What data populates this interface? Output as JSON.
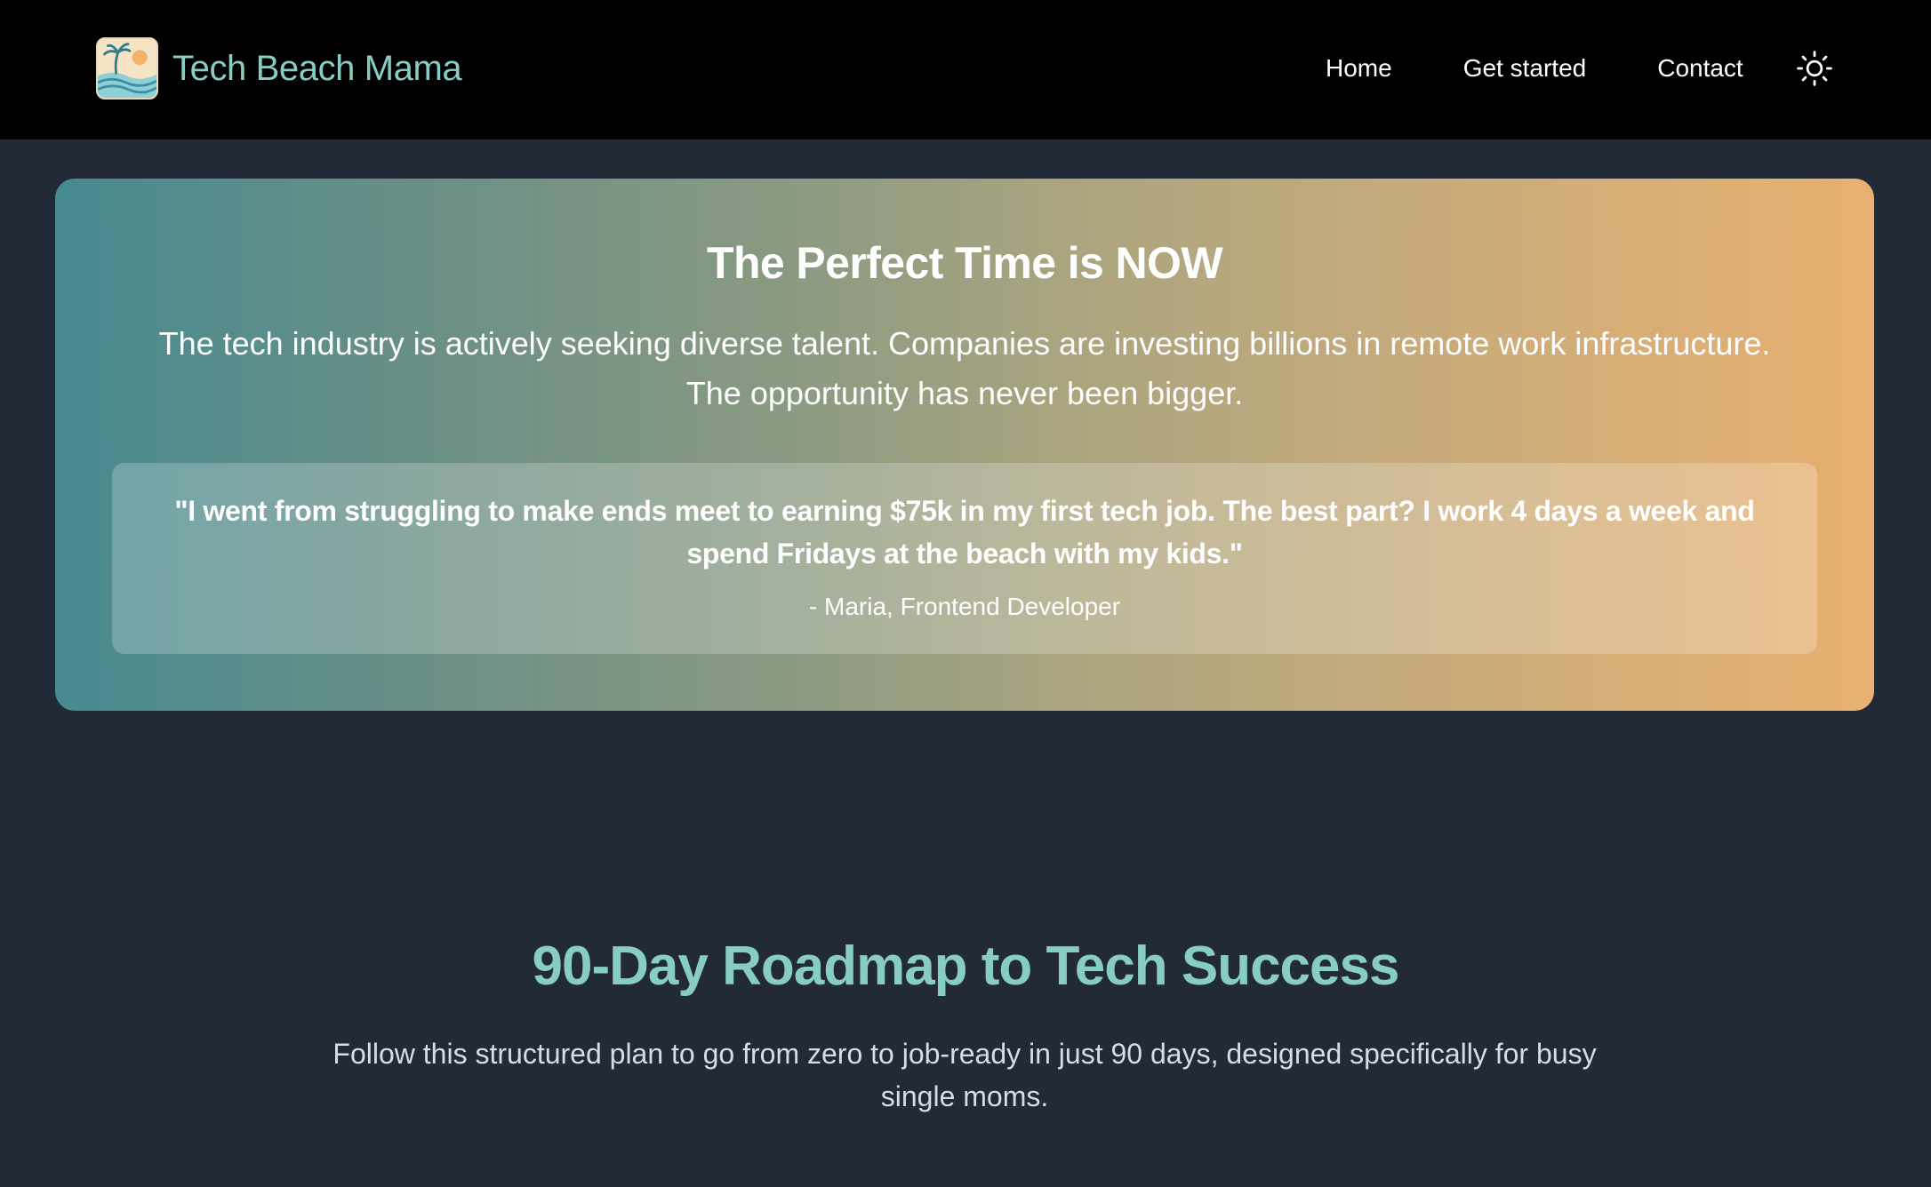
{
  "navbar": {
    "brand": {
      "name": "Tech Beach Mama",
      "logo_icon": "palm-beach-logo"
    },
    "links": [
      {
        "label": "Home"
      },
      {
        "label": "Get started"
      },
      {
        "label": "Contact"
      }
    ],
    "theme_toggle_icon": "sun-icon"
  },
  "hero": {
    "title": "The Perfect Time is NOW",
    "text": "The tech industry is actively seeking diverse talent. Companies are investing billions in remote work infrastructure. The opportunity has never been bigger.",
    "quote": {
      "text": "\"I went from struggling to make ends meet to earning $75k in my first tech job. The best part? I work 4 days a week and spend Fridays at the beach with my kids.\"",
      "author": "- Maria, Frontend Developer"
    }
  },
  "roadmap": {
    "title": "90-Day Roadmap to Tech Success",
    "subtitle": "Follow this structured plan to go from zero to job-ready in just 90 days, designed specifically for busy single moms."
  },
  "colors": {
    "page_background": "#222a38",
    "navbar_background": "#000000",
    "accent_teal": "#87cdc4",
    "gradient_start": "#478a91",
    "gradient_end": "#e8b171"
  }
}
